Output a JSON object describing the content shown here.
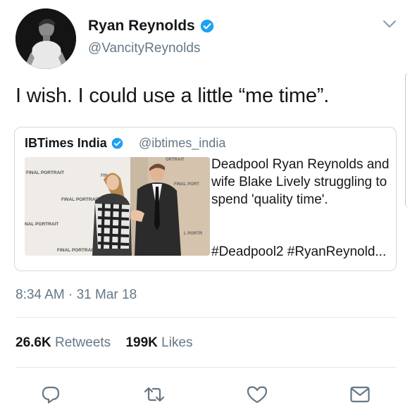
{
  "author": {
    "display_name": "Ryan Reynolds",
    "handle": "@VancityReynolds",
    "verified": true
  },
  "tweet": {
    "text": "I wish. I could use a little “me time”.",
    "timestamp": "8:34 AM · 31 Mar 18"
  },
  "quoted_tweet": {
    "display_name": "IBTimes India",
    "handle": "@ibtimes_india",
    "verified": true,
    "text": "Deadpool Ryan Reynolds and wife Blake Lively struggling to spend 'quality time'.",
    "hashtags": "#Deadpool2 #RyanReynold...",
    "image_backdrop_labels": [
      "FINAL PORTRAIT",
      "FINAL PORTRAIT",
      "NAL PORTRAIT",
      "FINAL PORTRAIT",
      "FINAL PORT",
      "L PORTR",
      "FIN",
      "ORTRAIT"
    ]
  },
  "stats": {
    "retweets_count": "26.6K",
    "retweets_label": "Retweets",
    "likes_count": "199K",
    "likes_label": "Likes"
  },
  "actions": [
    "reply-icon",
    "retweet-icon",
    "like-icon",
    "share-mail-icon"
  ],
  "colors": {
    "text": "#14171a",
    "secondary": "#657786",
    "verified_blue": "#1da1f2",
    "divider": "#e1e8ed"
  }
}
